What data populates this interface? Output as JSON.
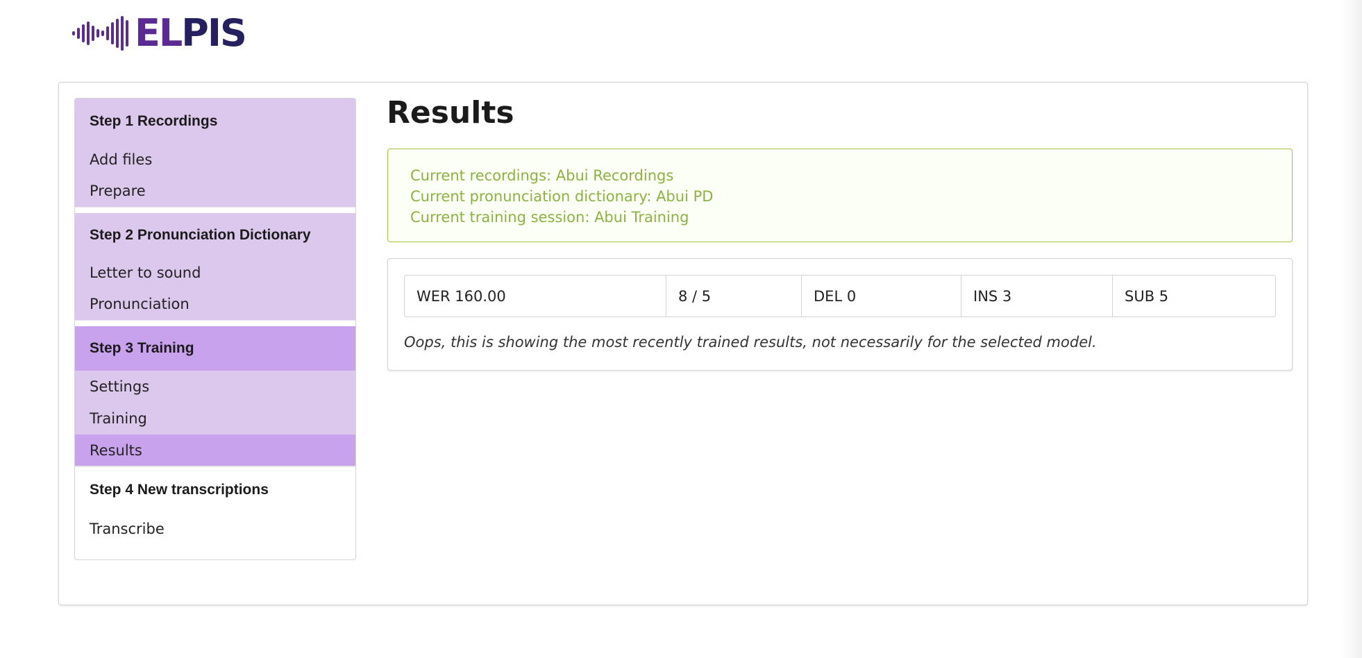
{
  "brand": {
    "logo_prefix": "EL",
    "logo_suffix": "PIS",
    "icon": "soundwave-icon"
  },
  "sidebar": {
    "steps": [
      {
        "title": "Step 1 Recordings",
        "items": [
          "Add files",
          "Prepare"
        ]
      },
      {
        "title": "Step 2 Pronunciation Dictionary",
        "items": [
          "Letter to sound",
          "Pronunciation"
        ]
      },
      {
        "title": "Step 3 Training",
        "items": [
          "Settings",
          "Training",
          "Results"
        ]
      },
      {
        "title": "Step 4 New transcriptions",
        "items": [
          "Transcribe"
        ]
      }
    ],
    "active_step": "Step 3 Training",
    "active_item": "Results"
  },
  "page": {
    "title": "Results"
  },
  "info": {
    "recordings": "Current recordings: Abui Recordings",
    "dictionary": "Current pronunciation dictionary: Abui PD",
    "training": "Current training session: Abui Training"
  },
  "results": {
    "metrics": [
      "WER 160.00",
      "8 / 5",
      "DEL 0",
      "INS 3",
      "SUB 5"
    ],
    "note": "Oops, this is showing the most recently trained results, not necessarily for the selected model."
  },
  "colors": {
    "active_purple": "#c8a2ec",
    "light_purple": "#dcc8ec",
    "info_green": "#8cb340",
    "info_border": "#a3c73c",
    "logo_purple": "#5b2a92",
    "logo_navy": "#252060"
  }
}
